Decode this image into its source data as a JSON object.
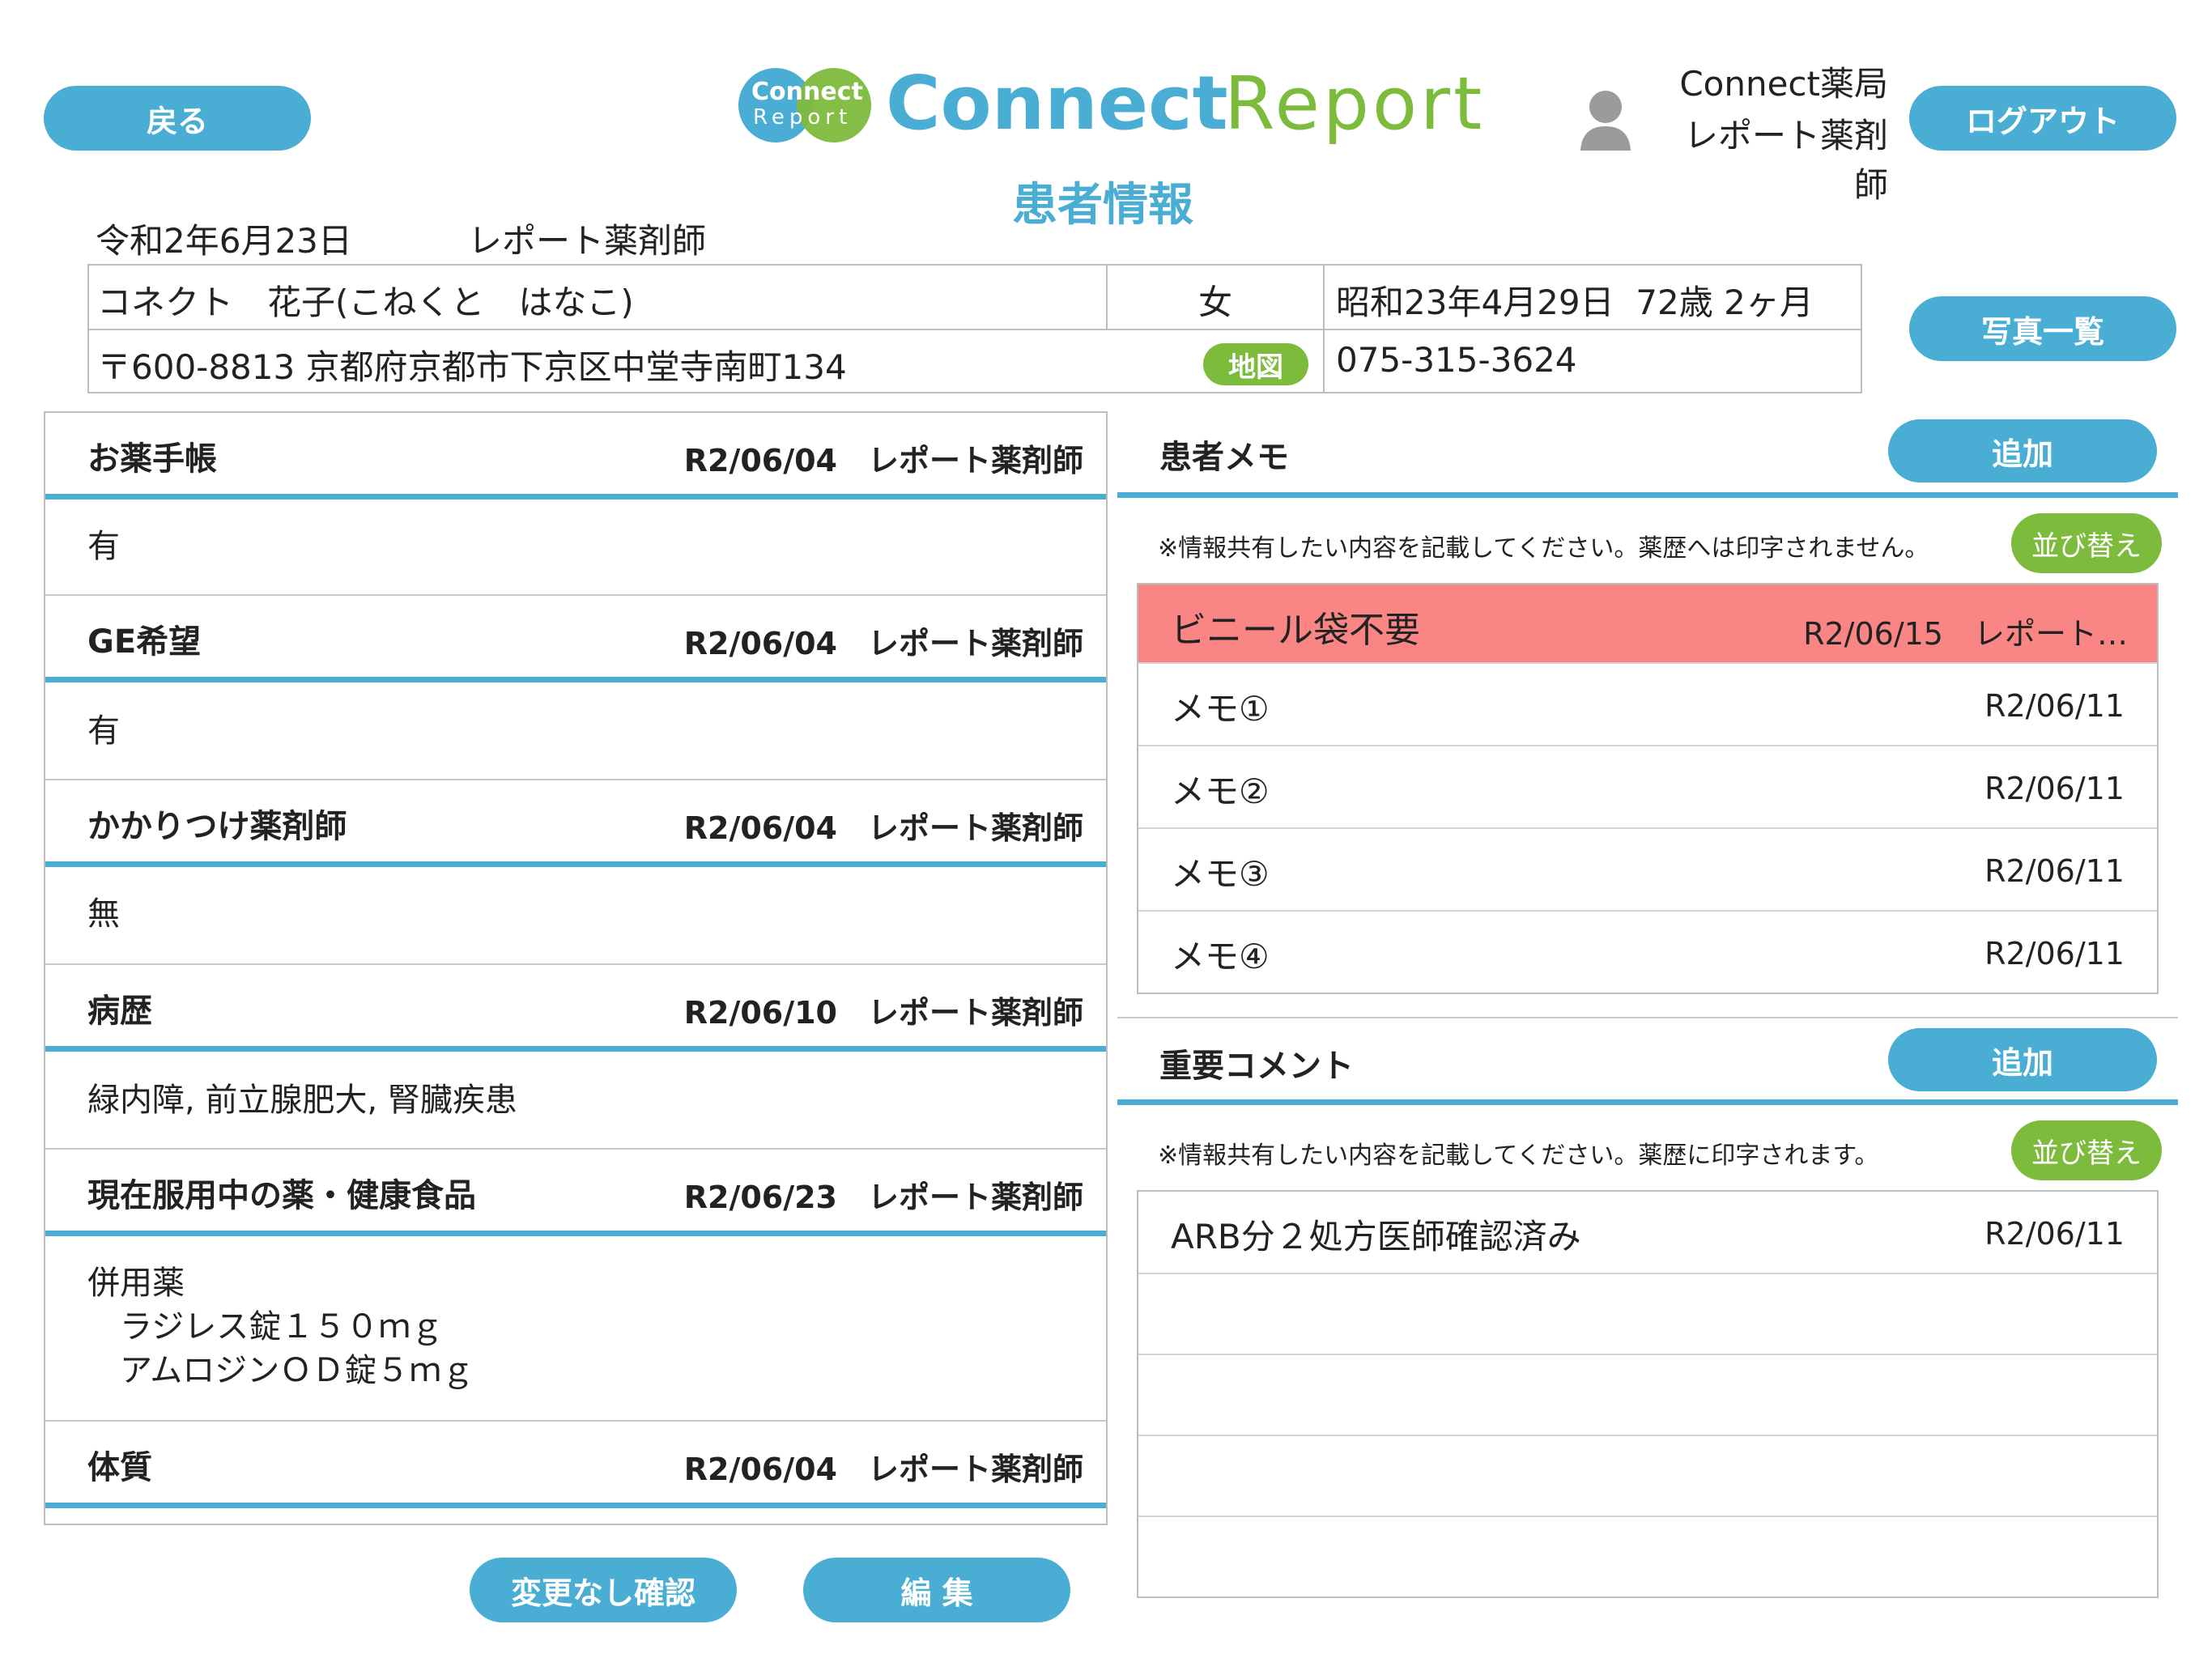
{
  "header": {
    "back_label": "戻る",
    "logout_label": "ログアウト",
    "logo_badge_top": "Connect",
    "logo_badge_bottom": "Report",
    "logo_word_1": "Connect",
    "logo_word_2": "Report",
    "pharmacy": "Connect薬局",
    "user": "レポート薬剤師",
    "page_title": "患者情報"
  },
  "info": {
    "date": "令和2年6月23日",
    "pharmacist": "レポート薬剤師",
    "name": "コネクト　花子(こねくと　はなこ)",
    "sex": "女",
    "birth": "昭和23年4月29日  72歳 2ヶ月",
    "address": "〒600-8813 京都府京都市下京区中堂寺南町134",
    "map_label": "地図",
    "phone": "075-315-3624",
    "photos_label": "写真一覧"
  },
  "sections": [
    {
      "title": "お薬手帳",
      "meta": "R2/06/04　レポート薬剤師",
      "value": "有"
    },
    {
      "title": "GE希望",
      "meta": "R2/06/04　レポート薬剤師",
      "value": "有"
    },
    {
      "title": "かかりつけ薬剤師",
      "meta": "R2/06/04　レポート薬剤師",
      "value": "無"
    },
    {
      "title": "病歴",
      "meta": "R2/06/10　レポート薬剤師",
      "value": "緑内障, 前立腺肥大, 腎臓疾患"
    },
    {
      "title": "現在服用中の薬・健康食品",
      "meta": "R2/06/23　レポート薬剤師",
      "value_lines": [
        "併用薬",
        "　ラジレス錠１５０ｍｇ",
        "　アムロジンＯＤ錠５ｍｇ"
      ]
    },
    {
      "title": "体質",
      "meta": "R2/06/04　レポート薬剤師"
    }
  ],
  "bottom_buttons": {
    "confirm_label": "変更なし確認",
    "edit_label": "編 集"
  },
  "memo": {
    "title": "患者メモ",
    "add_label": "追加",
    "sort_label": "並び替え",
    "note": "※情報共有したい内容を記載してください。薬歴へは印字されません。",
    "highlight": {
      "text": "ビニール袋不要",
      "meta": "R2/06/15　レポート…"
    },
    "items": [
      {
        "text": "メモ①",
        "date": "R2/06/11"
      },
      {
        "text": "メモ②",
        "date": "R2/06/11"
      },
      {
        "text": "メモ③",
        "date": "R2/06/11"
      },
      {
        "text": "メモ④",
        "date": "R2/06/11"
      }
    ],
    "highlight_color": "#f98585"
  },
  "comment": {
    "title": "重要コメント",
    "add_label": "追加",
    "sort_label": "並び替え",
    "note": "※情報共有したい内容を記載してください。薬歴に印字されます。",
    "items": [
      {
        "text": "ARB分２処方医師確認済み",
        "date": "R2/06/11"
      }
    ]
  },
  "colors": {
    "accent_blue": "#4aaed4",
    "accent_green": "#7dbb3c"
  },
  "icons": {
    "user": "user-silhouette-icon"
  }
}
